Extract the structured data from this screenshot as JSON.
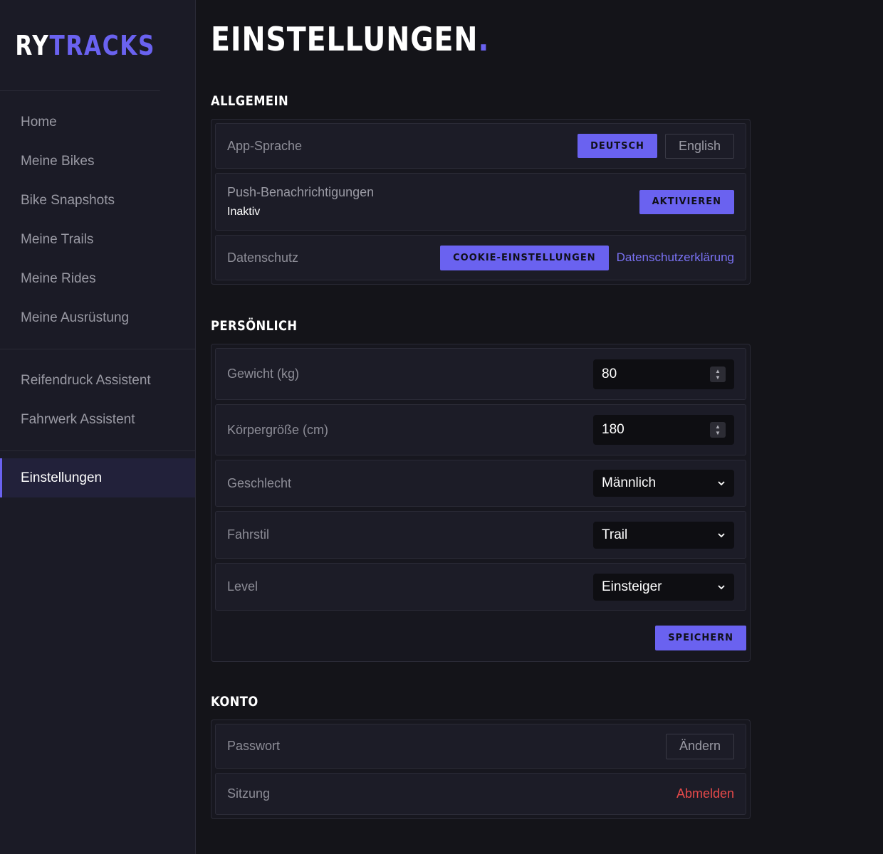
{
  "brand": {
    "part1": "RY",
    "part2": "TRACKS"
  },
  "sidebar": {
    "group1": [
      {
        "label": "Home"
      },
      {
        "label": "Meine Bikes"
      },
      {
        "label": "Bike Snapshots"
      },
      {
        "label": "Meine Trails"
      },
      {
        "label": "Meine Rides"
      },
      {
        "label": "Meine Ausrüstung"
      }
    ],
    "group2": [
      {
        "label": "Reifendruck Assistent"
      },
      {
        "label": "Fahrwerk Assistent"
      }
    ],
    "group3": [
      {
        "label": "Einstellungen"
      }
    ]
  },
  "page": {
    "title": "EINSTELLUNGEN",
    "title_dot": "."
  },
  "general": {
    "title": "ALLGEMEIN",
    "language": {
      "label": "App-Sprache",
      "option_active": "DEUTSCH",
      "option_other": "English"
    },
    "push": {
      "label": "Push-Benachrichtigungen",
      "status": "Inaktiv",
      "button": "AKTIVIEREN"
    },
    "privacy": {
      "label": "Datenschutz",
      "cookie_button": "COOKIE-EINSTELLUNGEN",
      "policy_link": "Datenschutzerklärung"
    }
  },
  "personal": {
    "title": "PERSÖNLICH",
    "weight": {
      "label": "Gewicht (kg)",
      "value": "80"
    },
    "height": {
      "label": "Körpergröße (cm)",
      "value": "180"
    },
    "gender": {
      "label": "Geschlecht",
      "value": "Männlich"
    },
    "style": {
      "label": "Fahrstil",
      "value": "Trail"
    },
    "level": {
      "label": "Level",
      "value": "Einsteiger"
    },
    "save": "SPEICHERN"
  },
  "account": {
    "title": "KONTO",
    "password": {
      "label": "Passwort",
      "button": "Ändern"
    },
    "session": {
      "label": "Sitzung",
      "button": "Abmelden"
    }
  },
  "colors": {
    "accent": "#6a62f0",
    "danger": "#e64a4a",
    "background": "#141419",
    "sidebar": "#1b1b26"
  }
}
